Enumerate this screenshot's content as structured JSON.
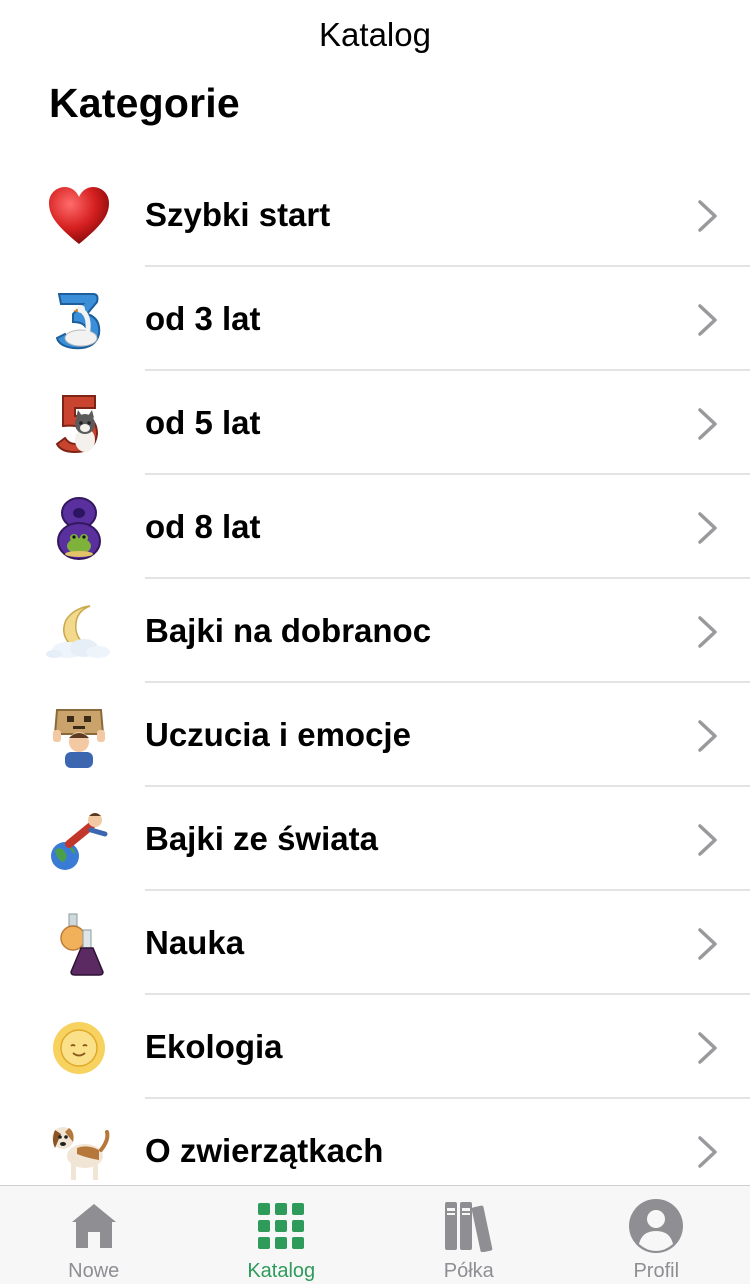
{
  "nav": {
    "title": "Katalog"
  },
  "section": {
    "title": "Kategorie"
  },
  "categories": [
    {
      "label": "Szybki start",
      "icon": "heart-icon"
    },
    {
      "label": "od 3 lat",
      "icon": "number-3-swan-icon"
    },
    {
      "label": "od 5 lat",
      "icon": "number-5-kitten-icon"
    },
    {
      "label": "od 8 lat",
      "icon": "number-8-frog-icon"
    },
    {
      "label": "Bajki na dobranoc",
      "icon": "moon-cloud-icon"
    },
    {
      "label": "Uczucia i emocje",
      "icon": "box-head-child-icon"
    },
    {
      "label": "Bajki ze świata",
      "icon": "child-on-globe-icon"
    },
    {
      "label": "Nauka",
      "icon": "flask-icon"
    },
    {
      "label": "Ekologia",
      "icon": "sun-icon"
    },
    {
      "label": "O zwierzątkach",
      "icon": "dog-icon"
    }
  ],
  "tabbar": {
    "tabs": [
      {
        "label": "Nowe",
        "icon": "house-icon",
        "active": false
      },
      {
        "label": "Katalog",
        "icon": "grid-icon",
        "active": true
      },
      {
        "label": "Półka",
        "icon": "books-icon",
        "active": false
      },
      {
        "label": "Profil",
        "icon": "person-icon",
        "active": false
      }
    ],
    "active_color": "#2e9b5b",
    "inactive_color": "#8e8e93"
  }
}
